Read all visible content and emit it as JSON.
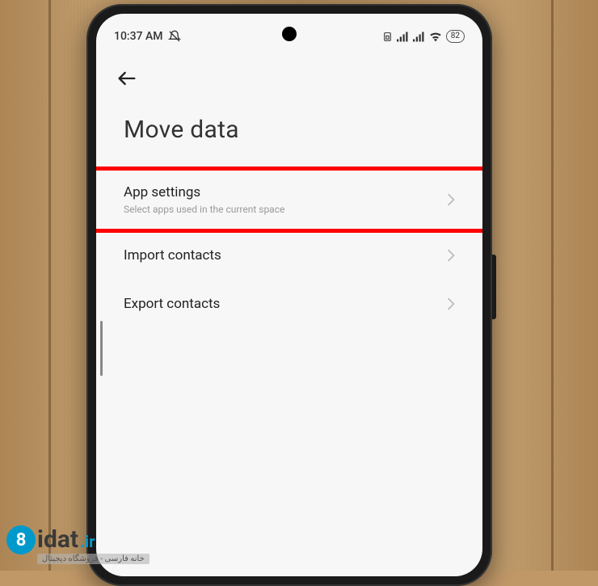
{
  "statusbar": {
    "time": "10:37 AM",
    "battery": "82"
  },
  "page": {
    "title": "Move data"
  },
  "items": [
    {
      "title": "App settings",
      "subtitle": "Select apps used in the current space",
      "highlighted": true
    },
    {
      "title": "Import contacts",
      "subtitle": null
    },
    {
      "title": "Export contacts",
      "subtitle": null
    }
  ],
  "watermark": {
    "circle": "8",
    "brand": "idat",
    "tld": ".ir",
    "tagline": "خانه فارسی - فروشگاه دیجیتال"
  }
}
